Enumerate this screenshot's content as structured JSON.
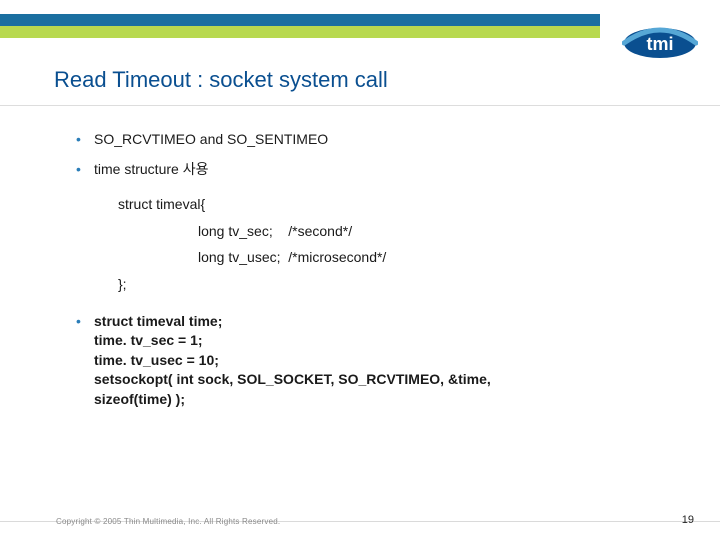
{
  "header": {
    "title": "Read Timeout : socket system call",
    "logo_text": "tmi",
    "logo_sub": ""
  },
  "bullets": {
    "b1": "SO_RCVTIMEO and SO_SENTIMEO",
    "b2": "time structure 사용"
  },
  "code": {
    "open": "struct timeval{",
    "l1": "long tv_sec;    /*second*/",
    "l2": "long tv_usec;  /*microsecond*/",
    "close": "};"
  },
  "bold": {
    "l1": "struct timeval time;",
    "l2": "time. tv_sec = 1;",
    "l3": "time. tv_usec = 10;",
    "l4": "setsockopt( int sock, SOL_SOCKET, SO_RCVTIMEO, &time,",
    "l5": "sizeof(time) );"
  },
  "footer": {
    "copyright": "Copyright © 2005 Thin Multimedia, Inc.  All Rights Reserved.",
    "page": "19"
  }
}
